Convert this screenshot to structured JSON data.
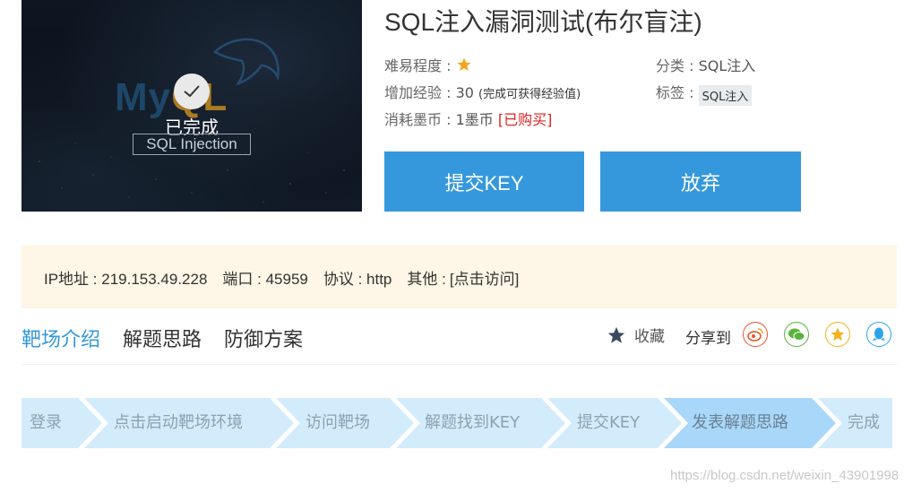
{
  "banner": {
    "logo_text_my": "My",
    "logo_text_ql": "QL",
    "status": "已完成",
    "subtitle": "SQL Injection"
  },
  "challenge": {
    "title": "SQL注入漏洞测试(布尔盲注)",
    "difficulty_label": "难易程度 : ",
    "difficulty_stars": 1,
    "category_label": "分类 : ",
    "category_value": "SQL注入",
    "exp_label": "增加经验 : ",
    "exp_value": "30",
    "exp_note": "(完成可获得经验值)",
    "tag_label": "标签 : ",
    "tag_value": "SQL注入",
    "cost_label": "消耗墨币 : ",
    "cost_value": "1墨币",
    "purchased": "[已购买]"
  },
  "buttons": {
    "submit_key": "提交KEY",
    "give_up": "放弃"
  },
  "target": {
    "ip_label": "IP地址 : ",
    "ip_value": "219.153.49.228",
    "port_label": "端口 : ",
    "port_value": "45959",
    "protocol_label": "协议 : ",
    "protocol_value": "http",
    "other_label": "其他 : ",
    "visit_link": "[点击访问]"
  },
  "tabs": [
    {
      "label": "靶场介绍",
      "active": true
    },
    {
      "label": "解题思路",
      "active": false
    },
    {
      "label": "防御方案",
      "active": false
    }
  ],
  "actions": {
    "favorite": "收藏",
    "share_to": "分享到",
    "share_targets": [
      "weibo-icon",
      "wechat-icon",
      "qzone-icon",
      "qq-icon"
    ]
  },
  "steps": [
    {
      "label": "登录",
      "state": "done"
    },
    {
      "label": "点击启动靶场环境",
      "state": "done"
    },
    {
      "label": "访问靶场",
      "state": "done"
    },
    {
      "label": "解题找到KEY",
      "state": "done"
    },
    {
      "label": "提交KEY",
      "state": "done"
    },
    {
      "label": "发表解题思路",
      "state": "current"
    },
    {
      "label": "完成",
      "state": "pending"
    }
  ],
  "watermark": "https://blog.csdn.net/weixin_43901998",
  "colors": {
    "primary": "#3598dc",
    "info_bg": "#fef6e6",
    "star": "#f5a623",
    "step_done": "#d3ecfb",
    "step_current": "#a9d7f9",
    "weibo": "#e6562b",
    "wechat": "#58b53b",
    "qzone": "#f3b21a",
    "qq": "#2ea4e8"
  }
}
